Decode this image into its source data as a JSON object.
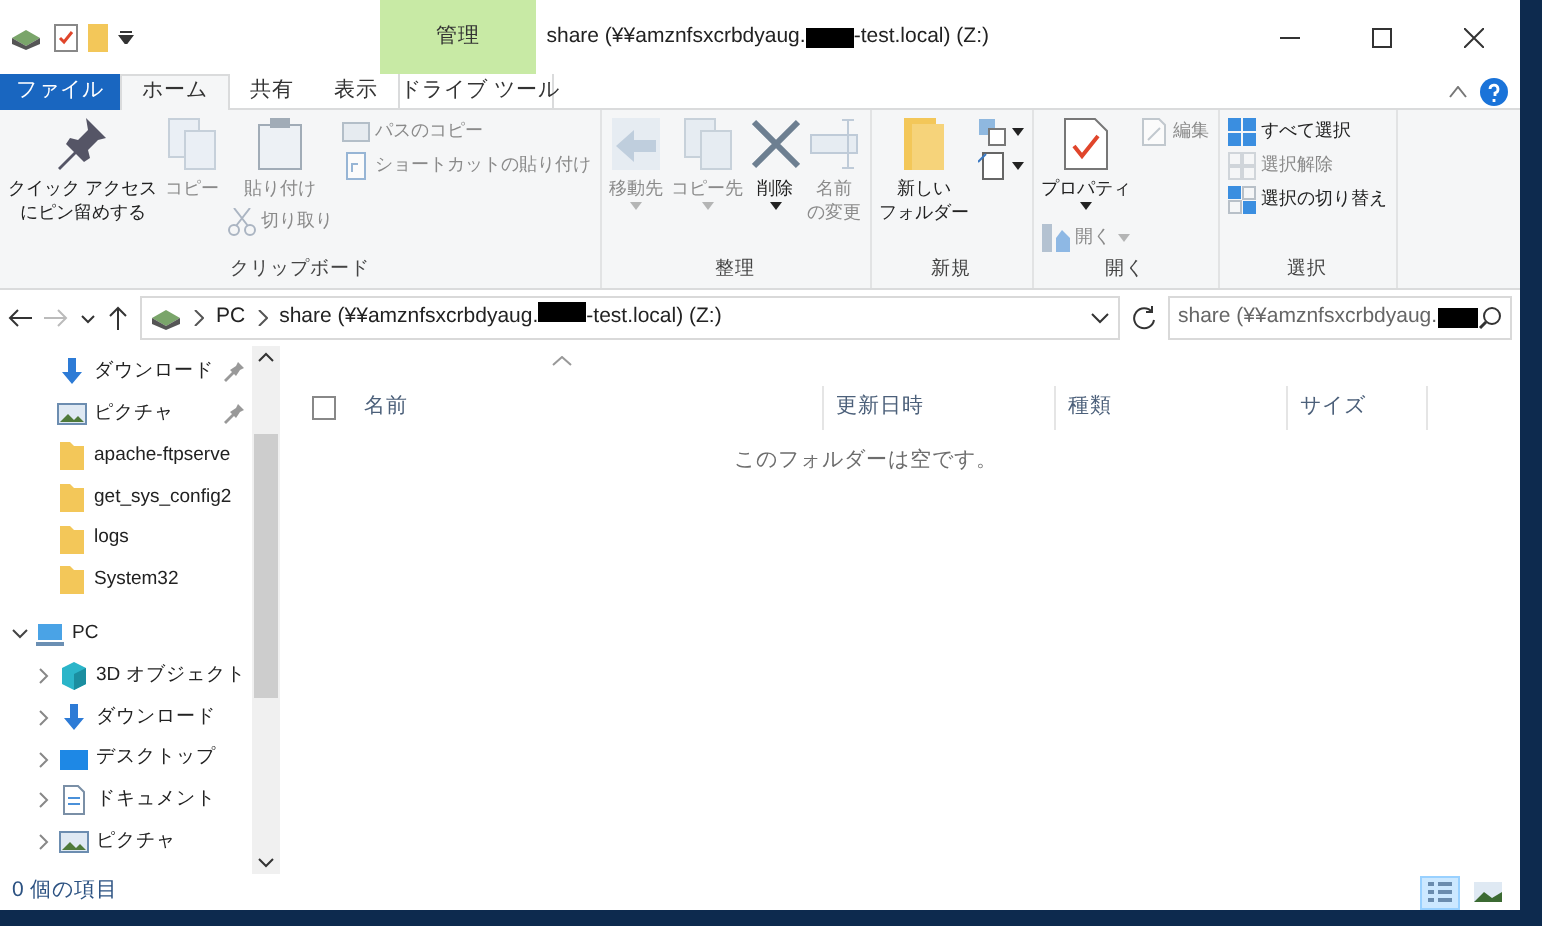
{
  "window": {
    "title_before": "share (¥¥amznfsxcrbdyaug.",
    "title_after": "-test.local) (Z:)",
    "context_tab": "管理",
    "redacted": true
  },
  "tabs": [
    {
      "label": "ファイル",
      "kind": "file",
      "selected": false
    },
    {
      "label": "ホーム",
      "kind": "tab",
      "selected": true
    },
    {
      "label": "共有",
      "kind": "tab",
      "selected": false
    },
    {
      "label": "表示",
      "kind": "tab",
      "selected": false
    },
    {
      "label": "ドライブ ツール",
      "kind": "context",
      "selected": false
    }
  ],
  "ribbon": [
    {
      "label": "クリップボード",
      "items": [
        {
          "kind": "large",
          "label_lines": [
            "クイック アクセス",
            "にピン留めする"
          ],
          "disabled": false
        },
        {
          "kind": "large",
          "label_lines": [
            "コピー"
          ],
          "disabled": true
        },
        {
          "kind": "stack",
          "children": [
            {
              "kind": "large",
              "label_lines": [
                "貼り付け"
              ],
              "disabled": true
            },
            {
              "kind": "small",
              "label": "切り取り",
              "disabled": true
            }
          ]
        },
        {
          "kind": "stack",
          "children": [
            {
              "kind": "small",
              "label": "パスのコピー",
              "disabled": true
            },
            {
              "kind": "small",
              "label": "ショートカットの貼り付け",
              "disabled": true
            }
          ]
        }
      ]
    },
    {
      "label": "整理",
      "items": [
        {
          "kind": "large",
          "label_lines": [
            "移動先"
          ],
          "disabled": true,
          "dropdown": true
        },
        {
          "kind": "large",
          "label_lines": [
            "コピー先"
          ],
          "disabled": true,
          "dropdown": true
        },
        {
          "kind": "large",
          "label_lines": [
            "削除"
          ],
          "disabled": false,
          "dropdown": true
        },
        {
          "kind": "large",
          "label_lines": [
            "名前",
            "の変更"
          ],
          "disabled": true
        }
      ]
    },
    {
      "label": "新規",
      "items": [
        {
          "kind": "large",
          "label_lines": [
            "新しい",
            "フォルダー"
          ],
          "disabled": false
        },
        {
          "kind": "stack",
          "children": [
            {
              "kind": "small",
              "disabled": false,
              "dropdown": true
            },
            {
              "kind": "small",
              "disabled": false,
              "dropdown": true
            }
          ]
        }
      ]
    },
    {
      "label": "開く",
      "items": [
        {
          "kind": "stack",
          "children": [
            {
              "kind": "large",
              "label_lines": [
                "プロパティ"
              ],
              "disabled": false,
              "dropdown": true
            },
            {
              "kind": "small",
              "label": "開く",
              "disabled": true,
              "dropdown": true
            }
          ]
        },
        {
          "kind": "stack",
          "children": [
            {
              "kind": "small",
              "label": "編集",
              "disabled": true
            }
          ]
        }
      ]
    },
    {
      "label": "選択",
      "items": [
        {
          "kind": "stack",
          "children": [
            {
              "kind": "small",
              "label": "すべて選択",
              "disabled": false
            },
            {
              "kind": "small",
              "label": "選択解除",
              "disabled": true
            },
            {
              "kind": "small",
              "label": "選択の切り替え",
              "disabled": false
            }
          ]
        }
      ]
    }
  ],
  "address": {
    "crumbs": [
      "PC",
      "share (¥¥amznfsxcrbdyaug.",
      "-test.local) (Z:)"
    ],
    "search_placeholder": "share (¥¥amznfsxcrbdyaug."
  },
  "navigation": [
    {
      "label": "ダウンロード",
      "kind": "download",
      "pinned": true
    },
    {
      "label": "ピクチャ",
      "kind": "pictures",
      "pinned": true
    },
    {
      "label": "apache-ftpserve",
      "kind": "folder",
      "pinned": false
    },
    {
      "label": "get_sys_config2",
      "kind": "folder",
      "pinned": false
    },
    {
      "label": "logs",
      "kind": "folder",
      "pinned": false
    },
    {
      "label": "System32",
      "kind": "folder",
      "pinned": false
    },
    {
      "label": "PC",
      "kind": "pc",
      "expanded": true,
      "children": [
        {
          "label": "3D オブジェクト",
          "kind": "objects",
          "expanded": false
        },
        {
          "label": "ダウンロード",
          "kind": "download",
          "expanded": false
        },
        {
          "label": "デスクトップ",
          "kind": "desktop",
          "expanded": false
        },
        {
          "label": "ドキュメント",
          "kind": "documents",
          "expanded": false
        },
        {
          "label": "ピクチャ",
          "kind": "pictures",
          "expanded": false
        }
      ]
    }
  ],
  "table": {
    "columns": [
      "名前",
      "更新日時",
      "種類",
      "サイズ"
    ],
    "select_all_checked": false,
    "empty_message": "このフォルダーは空です。"
  },
  "status_bar": {
    "text": "0 個の項目",
    "views": [
      {
        "kind": "details",
        "selected": true
      },
      {
        "kind": "large-icons",
        "selected": false
      }
    ]
  }
}
